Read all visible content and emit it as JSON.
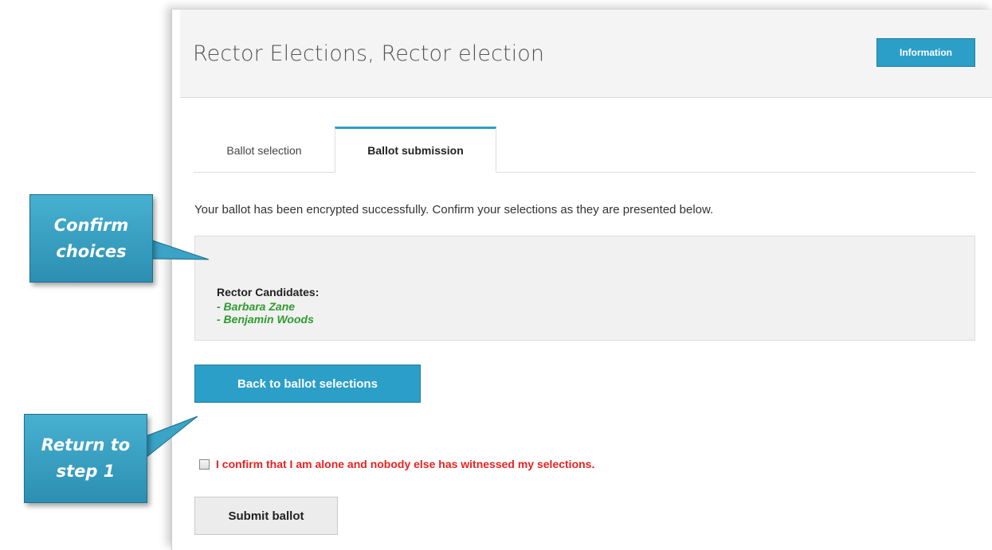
{
  "header": {
    "title": "Rector Elections, Rector election",
    "info_label": "Information"
  },
  "tabs": [
    {
      "label": "Ballot selection",
      "active": false
    },
    {
      "label": "Ballot submission",
      "active": true
    }
  ],
  "main": {
    "intro": "Your ballot has been encrypted successfully. Confirm your selections as they are presented below.",
    "selections": {
      "heading": "Rector Candidates:",
      "items": [
        "- Barbara Zane",
        "- Benjamin Woods"
      ]
    },
    "back_label": "Back to ballot selections",
    "confirm_label": "I confirm that I am alone and nobody else has witnessed my selections.",
    "submit_label": "Submit ballot"
  },
  "callouts": {
    "confirm": {
      "line1": "Confirm",
      "line2": "choices"
    },
    "return": {
      "line1": "Return to",
      "line2": "step 1"
    }
  },
  "colors": {
    "accent": "#2b9fc7",
    "selection_text": "#2e9c2e",
    "warning_text": "#e8231f",
    "callout": "#3aa3c6"
  }
}
